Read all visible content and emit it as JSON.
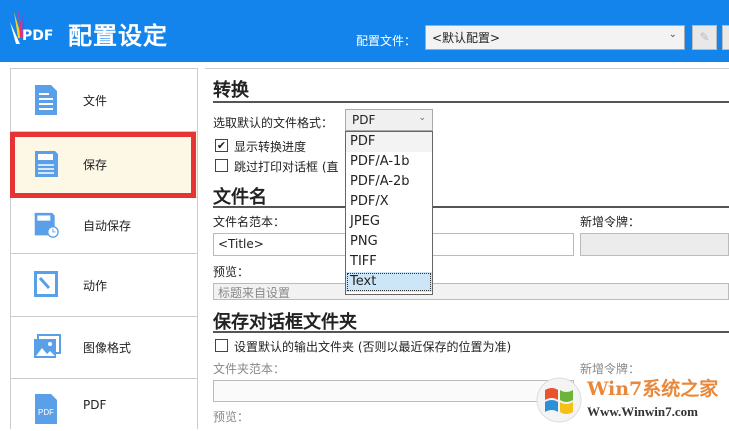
{
  "header": {
    "title": "配置设定",
    "logo_text": "PDF",
    "profile_label": "配置文件：",
    "profile_value": "<默认配置>"
  },
  "sidebar": {
    "items": [
      {
        "label": "文件",
        "icon": "document-icon"
      },
      {
        "label": "保存",
        "icon": "save-icon"
      },
      {
        "label": "自动保存",
        "icon": "autosave-icon"
      },
      {
        "label": "动作",
        "icon": "wrench-icon"
      },
      {
        "label": "图像格式",
        "icon": "image-icon"
      },
      {
        "label": "PDF",
        "icon": "pdf-icon"
      }
    ],
    "active": "保存"
  },
  "convert": {
    "heading": "转换",
    "format_label": "选取默认的文件格式：",
    "format_value": "PDF",
    "options": [
      "PDF",
      "PDF/A-1b",
      "PDF/A-2b",
      "PDF/X",
      "JPEG",
      "PNG",
      "TIFF",
      "Text"
    ],
    "highlighted": "Text",
    "show_progress": {
      "label": "显示转换进度",
      "checked": true
    },
    "skip_print": {
      "label": "跳过打印对话框 (直",
      "checked": false
    }
  },
  "filename": {
    "heading": "文件名",
    "template_label": "文件名范本：",
    "template_value": "<Title>",
    "token_label": "新增令牌：",
    "preview_label": "预览：",
    "preview_value": "标题来自设置"
  },
  "folder": {
    "heading": "保存对话框文件夹",
    "default_folder": {
      "label": "设置默认的输出文件夹 (否则以最近保存的位置为准)",
      "checked": false
    },
    "template_label": "文件夹范本：",
    "token_label": "新增令牌：",
    "preview_label": "预览："
  },
  "watermark": {
    "title": "Win7系统之家",
    "url": "Www.Winwin7.com"
  },
  "colors": {
    "header": "#1384ec",
    "icon": "#5aa0e8",
    "highlight": "#e63333"
  }
}
